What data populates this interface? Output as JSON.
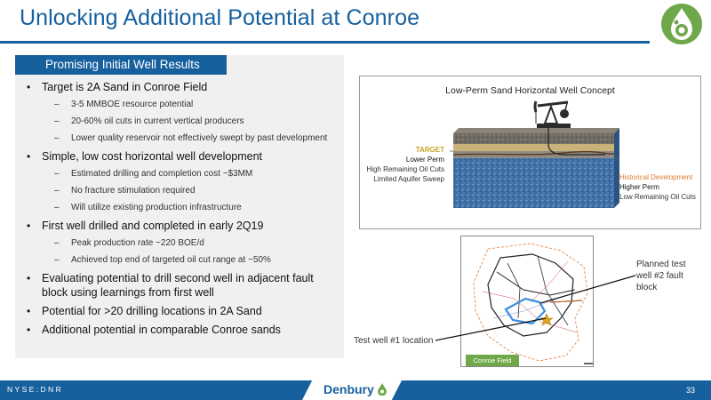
{
  "title": "Unlocking Additional Potential at Conroe",
  "panel": {
    "heading": "Promising Initial Well Results",
    "bullets": [
      {
        "text": "Target is 2A Sand in Conroe Field",
        "subs": [
          "3-5 MMBOE resource potential",
          "20-60% oil cuts in current vertical producers",
          "Lower quality reservoir not effectively swept by past development"
        ]
      },
      {
        "text": "Simple, low cost horizontal well development",
        "subs": [
          "Estimated drilling and completion cost ~$3MM",
          "No fracture stimulation required",
          "Will utilize existing production infrastructure"
        ]
      },
      {
        "text": "First well drilled and completed in early 2Q19",
        "subs": [
          "Peak production rate ~220 BOE/d",
          "Achieved top end of targeted oil cut range at ~50%"
        ]
      },
      {
        "text": "Evaluating potential to drill second well in adjacent fault block using learnings from first well",
        "subs": []
      },
      {
        "text": "Potential for >20 drilling locations in 2A Sand",
        "subs": []
      },
      {
        "text": "Additional potential in comparable Conroe sands",
        "subs": []
      }
    ]
  },
  "concept": {
    "title": "Low-Perm Sand Horizontal Well Concept",
    "left": {
      "target": "TARGET",
      "perm": "Lower Perm",
      "line1": "High Remaining Oil Cuts",
      "line2": "Limited Aquifer Sweep"
    },
    "right": {
      "heading": "Historical Development",
      "perm": "Higher Perm",
      "line1": "Low Remaining Oil Cuts"
    }
  },
  "map": {
    "badge": "Conroe Field",
    "planned_callout": "Planned test well #2 fault block",
    "test_callout": "Test well #1 location"
  },
  "footer": {
    "ticker": "NYSE:DNR",
    "brand": "Denbury",
    "page": "33"
  },
  "colors": {
    "brand_blue": "#17609e",
    "brand_green": "#6fa84a",
    "target_gold": "#c9a227",
    "historical_orange": "#e07a2e"
  }
}
